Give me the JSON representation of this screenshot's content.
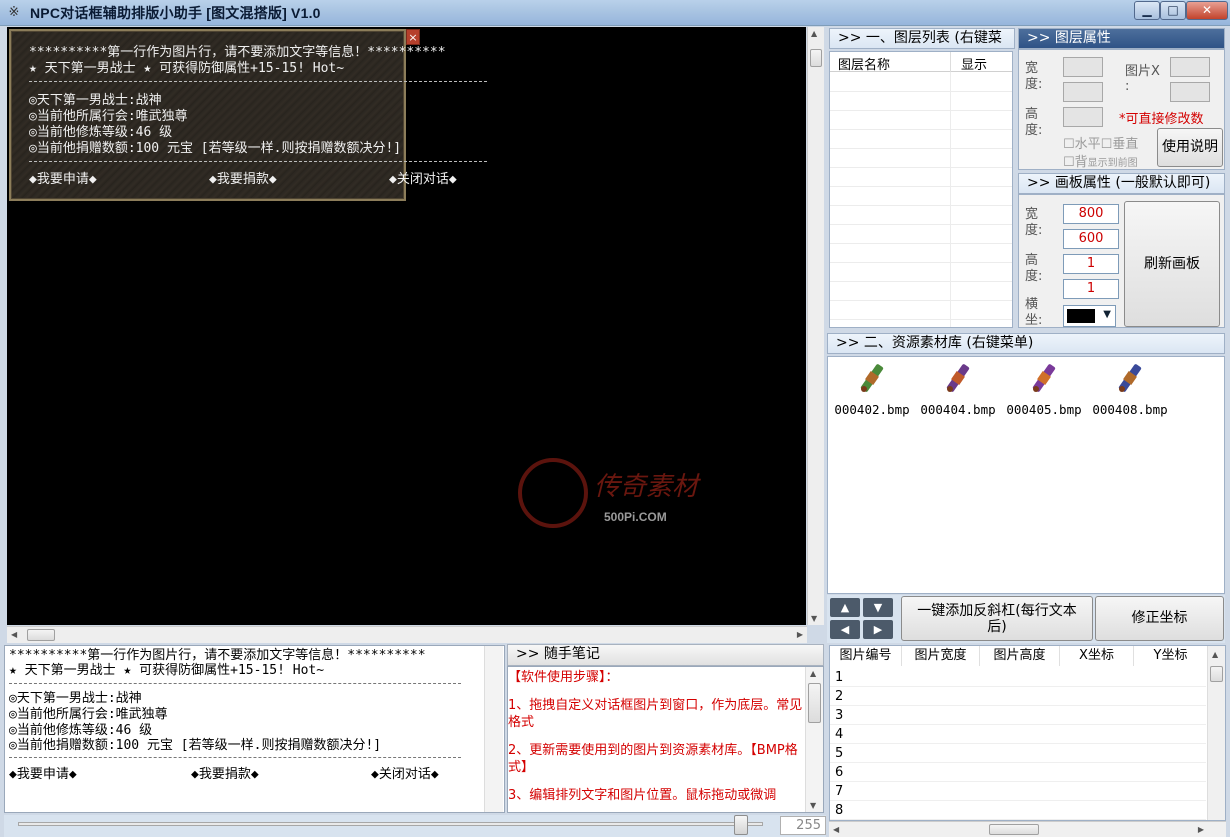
{
  "window": {
    "title": "NPC对话框辅助排版小助手 [图文混搭版] V1.0",
    "app_icon": "※",
    "buttons": {
      "minimize": "▁",
      "maximize": "□",
      "close": "✕"
    }
  },
  "canvas": {
    "background": "#000000",
    "dialog_text": {
      "line1": "**********第一行作为图片行，请不要添加文字等信息！**********",
      "line2": "★ 天下第一男战士 ★    可获得防御属性+15-15!  Hot~",
      "line3": "◎天下第一男战士:战神",
      "line4": "◎当前他所属行会:唯武独尊",
      "line5": "◎当前他修炼等级:46 级",
      "line6": "◎当前他捐赠数额:100 元宝 [若等级一样.则按捐赠数额决分!]",
      "opt1": "◆我要申请◆",
      "opt2": "◆我要捐款◆",
      "opt3": "◆关闭对话◆"
    },
    "dialog_close": "×",
    "watermark": {
      "text": "传奇素材",
      "url": "500Pi.COM"
    }
  },
  "preview": {
    "line1": "**********第一行作为图片行，请不要添加文字等信息！**********",
    "line2": "★ 天下第一男战士 ★    可获得防御属性+15-15!  Hot~",
    "line3": "◎天下第一男战士:战神",
    "line4": "◎当前他所属行会:唯武独尊",
    "line5": "◎当前他修炼等级:46 级",
    "line6": "◎当前他捐赠数额:100 元宝 [若等级一样.则按捐赠数额决分!]",
    "opt1": "◆我要申请◆",
    "opt2": "◆我要捐款◆",
    "opt3": "◆关闭对话◆"
  },
  "notes": {
    "header": ">> 随手笔记",
    "p1": "【软件使用步骤】：",
    "p2": "1、拖拽自定义对话框图片到窗口，作为底层。常见格式",
    "p3": "2、更新需要使用到的图片到资源素材库。【BMP格式】",
    "p4": "3、编辑排列文字和图片位置。鼠标拖动或微调"
  },
  "slider": {
    "value": "255",
    "level": 0.98
  },
  "layer_list": {
    "header": ">> 一、图层列表 (右键菜",
    "col_name": "图层名称",
    "col_show": "显示"
  },
  "layer_props": {
    "header": ">> 图层属性",
    "width_label": "宽度:",
    "height_label": "高度:",
    "image_x_label": "图片X :",
    "hint": "*可直接修改数",
    "check_h": "水平",
    "check_v": "垂直",
    "check_bg": "背",
    "check_extra": "显示到前图",
    "help_button": "使用说明"
  },
  "board_props": {
    "header": ">> 画板属性 (一般默认即可)",
    "width_label": "宽度:",
    "height_label": "高度:",
    "cross_label": "横坐:",
    "width_value": "800",
    "height_value": "600",
    "v3": "1",
    "v4": "1",
    "color": "#000000",
    "refresh_button": "刷新画板"
  },
  "resources": {
    "header": ">> 二、资源素材库 (右键菜单)",
    "items": [
      {
        "name": "000402.bmp",
        "icon": "scroll-icon"
      },
      {
        "name": "000404.bmp",
        "icon": "scroll-icon"
      },
      {
        "name": "000405.bmp",
        "icon": "scroll-icon"
      },
      {
        "name": "000408.bmp",
        "icon": "scroll-icon"
      }
    ]
  },
  "actions": {
    "arrow_up": "▲",
    "arrow_down": "▼",
    "arrow_left": "◀",
    "arrow_right": "▶",
    "add_slash": "一键添加反斜杠(每行文本后)",
    "fix_coords": "修正坐标"
  },
  "coord_table": {
    "headers": [
      "图片编号",
      "图片宽度",
      "图片高度",
      "X坐标",
      "Y坐标"
    ],
    "rows": [
      "1",
      "2",
      "3",
      "4",
      "5",
      "6",
      "7",
      "8"
    ]
  }
}
